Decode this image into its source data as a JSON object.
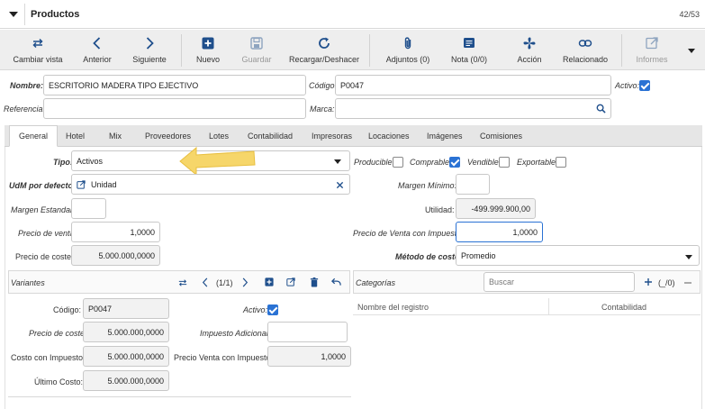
{
  "header": {
    "title": "Productos",
    "counter": "42/53"
  },
  "toolbar": [
    {
      "label": "Cambiar vista",
      "icon": "swap-arrows-icon"
    },
    {
      "label": "Anterior",
      "icon": "chevron-left-icon"
    },
    {
      "label": "Siguiente",
      "icon": "chevron-right-icon"
    },
    {
      "label": "Nuevo",
      "icon": "plus-square-icon"
    },
    {
      "label": "Guardar",
      "icon": "save-icon"
    },
    {
      "label": "Recargar/Deshacer",
      "icon": "reload-icon"
    },
    {
      "label": "Adjuntos (0)",
      "icon": "paperclip-icon"
    },
    {
      "label": "Nota (0/0)",
      "icon": "note-icon"
    },
    {
      "label": "Acción",
      "icon": "fan-icon"
    },
    {
      "label": "Relacionado",
      "icon": "link-icon"
    },
    {
      "label": "Informes",
      "icon": "external-report-icon"
    }
  ],
  "top": {
    "nombre_label": "Nombre:",
    "nombre_value": "ESCRITORIO MADERA TIPO EJECTIVO",
    "codigo_label": "Código:",
    "codigo_value": "P0047",
    "activo_label": "Activo:",
    "referencia_label": "Referencia:",
    "referencia_value": "",
    "marca_label": "Marca:",
    "marca_value": ""
  },
  "tabs": [
    "General",
    "Hotel",
    "Mix",
    "Proveedores",
    "Lotes",
    "Contabilidad",
    "Impresoras",
    "Locaciones",
    "Imágenes",
    "Comisiones"
  ],
  "general": {
    "tipo_label": "Tipo:",
    "tipo_value": "Activos",
    "udm_label": "UdM por defecto:",
    "udm_value": "Unidad",
    "margen_estandar_label": "Margen Estandar:",
    "margen_estandar_value": "",
    "precio_venta_label": "Precio de venta:",
    "precio_venta_value": "1,0000",
    "precio_coste_label": "Precio de coste:",
    "precio_coste_value": "5.000.000,0000",
    "producible_label": "Producible:",
    "comprable_label": "Comprable:",
    "vendible_label": "Vendible:",
    "exportable_label": "Exportable:",
    "margen_minimo_label": "Margen Mínimo:",
    "margen_minimo_value": "",
    "utilidad_label": "Utilidad:",
    "utilidad_value": "-499.999.900,00",
    "pv_impuesto_label": "Precio de Venta con Impuesto:",
    "pv_impuesto_value": "1,0000",
    "metodo_coste_label": "Método de coste:",
    "metodo_coste_value": "Promedio"
  },
  "variantes": {
    "title": "Variantes",
    "pager": "(1/1)",
    "codigo_label": "Código:",
    "codigo_value": "P0047",
    "activo_label": "Activo:",
    "precio_coste_label": "Precio de coste:",
    "precio_coste_value": "5.000.000,0000",
    "impuesto_adicional_label": "Impuesto Adicional:",
    "impuesto_adicional_value": "",
    "costo_impuesto_label": "Costo con Impuesto:",
    "costo_impuesto_value": "5.000.000,0000",
    "pv_impuesto_label": "Precio Venta con Impuesto:",
    "pv_impuesto_value": "1,0000",
    "ultimo_costo_label": "Último Costo:",
    "ultimo_costo_value": "5.000.000,0000"
  },
  "categorias": {
    "title": "Categorías",
    "search_placeholder": "Buscar",
    "count": "_/0",
    "col_nombre": "Nombre del registro",
    "col_contabilidad": "Contabilidad"
  },
  "colors": {
    "accent": "#2a72d4",
    "toolbar_icon": "#1f4f8c",
    "arrow": "#f6d66a"
  }
}
